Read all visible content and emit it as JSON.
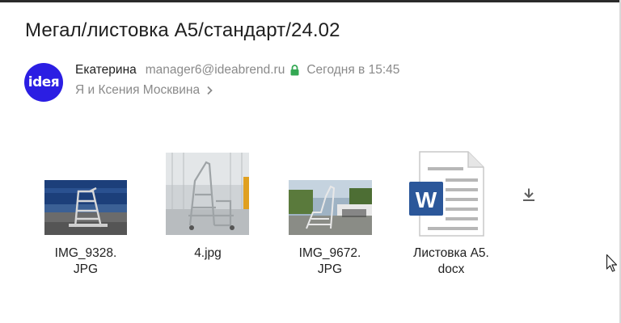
{
  "message": {
    "subject": "Мегал/листовка А5/стандарт/24.02",
    "avatar_text": "ideя",
    "sender_name": "Екатерина",
    "sender_email": "manager6@ideabrend.ru",
    "date": "Сегодня в 15:45",
    "recipients": "Я и Ксения Москвина"
  },
  "attachments": [
    {
      "name_line1": "IMG_9328.",
      "name_line2": "JPG"
    },
    {
      "name_line1": "4.jpg",
      "name_line2": ""
    },
    {
      "name_line1": "IMG_9672.",
      "name_line2": "JPG"
    },
    {
      "name_line1": "Листовка А5.",
      "name_line2": "docx"
    }
  ],
  "colors": {
    "avatar_bg": "#2b1ee3",
    "lock_green": "#34a853",
    "muted_text": "#8a8a8a",
    "word_blue": "#2b579a"
  },
  "icons": [
    "lock-icon",
    "chevron-right-icon",
    "download-icon",
    "word-doc-icon",
    "mouse-cursor-icon"
  ]
}
